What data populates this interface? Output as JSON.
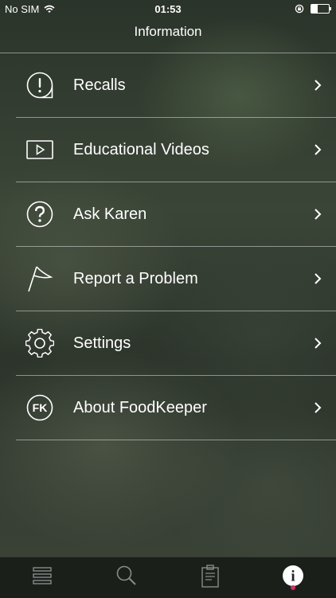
{
  "status_bar": {
    "carrier": "No SIM",
    "time": "01:53",
    "battery_level": 0.35
  },
  "nav": {
    "title": "Information"
  },
  "menu": {
    "items": [
      {
        "label": "Recalls",
        "icon": "exclamation-bubble-icon"
      },
      {
        "label": "Educational Videos",
        "icon": "play-video-icon"
      },
      {
        "label": "Ask Karen",
        "icon": "question-circle-icon"
      },
      {
        "label": "Report a Problem",
        "icon": "flag-icon"
      },
      {
        "label": "Settings",
        "icon": "gear-icon"
      },
      {
        "label": "About FoodKeeper",
        "icon": "foodkeeper-logo-icon",
        "logo_text": "FK"
      }
    ]
  },
  "tab_bar": {
    "tabs": [
      {
        "icon": "categories-list-icon"
      },
      {
        "icon": "search-icon"
      },
      {
        "icon": "clipboard-icon"
      },
      {
        "icon": "info-icon",
        "glyph": "i"
      }
    ],
    "active_index": 3,
    "accent_color": "#d0306a"
  }
}
